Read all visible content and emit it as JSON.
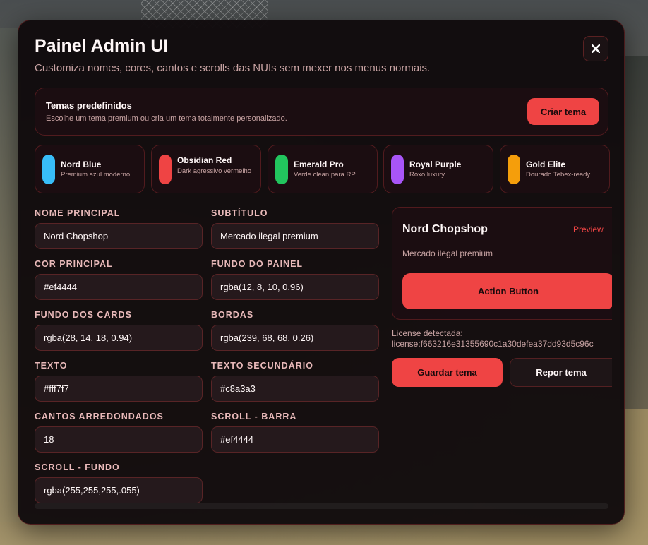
{
  "header": {
    "title": "Painel Admin UI",
    "subtitle": "Customiza nomes, cores, cantos e scrolls das NUIs sem mexer nos menus normais."
  },
  "themes": {
    "title": "Temas predefinidos",
    "description": "Escolhe um tema premium ou cria um tema totalmente personalizado.",
    "create_label": "Criar tema"
  },
  "presets": [
    {
      "name": "Nord Blue",
      "description": "Premium azul moderno",
      "color": "#38bdf8"
    },
    {
      "name": "Obsidian Red",
      "description": "Dark agressivo vermelho",
      "color": "#ef4444"
    },
    {
      "name": "Emerald Pro",
      "description": "Verde clean para RP",
      "color": "#22c55e"
    },
    {
      "name": "Royal Purple",
      "description": "Roxo luxury",
      "color": "#a855f7"
    },
    {
      "name": "Gold Elite",
      "description": "Dourado Tebex-ready",
      "color": "#f59e0b"
    }
  ],
  "fields": {
    "nome_principal": {
      "label": "Nome principal",
      "value": "Nord Chopshop"
    },
    "subtitulo": {
      "label": "Subtítulo",
      "value": "Mercado ilegal premium"
    },
    "cor_principal": {
      "label": "Cor principal",
      "value": "#ef4444"
    },
    "fundo_painel": {
      "label": "Fundo do painel",
      "value": "rgba(12, 8, 10, 0.96)"
    },
    "fundo_cards": {
      "label": "Fundo dos cards",
      "value": "rgba(28, 14, 18, 0.94)"
    },
    "bordas": {
      "label": "Bordas",
      "value": "rgba(239, 68, 68, 0.26)"
    },
    "texto": {
      "label": "Texto",
      "value": "#fff7f7"
    },
    "texto_secundario": {
      "label": "Texto secundário",
      "value": "#c8a3a3"
    },
    "cantos": {
      "label": "Cantos arredondados",
      "value": "18"
    },
    "scroll_barra": {
      "label": "Scroll - barra",
      "value": "#ef4444"
    },
    "scroll_fundo": {
      "label": "Scroll - fundo",
      "value": "rgba(255,255,255,.055)"
    }
  },
  "preview": {
    "name": "Nord Chopshop",
    "tag": "Preview",
    "subtitle": "Mercado ilegal premium",
    "action_label": "Action Button"
  },
  "license": {
    "label": "License detectada:",
    "value": "license:f663216e31355690c1a30defea37dd93d5c96c"
  },
  "actions": {
    "save_label": "Guardar tema",
    "reset_label": "Repor tema"
  },
  "colors": {
    "accent": "#ef4444",
    "text": "#fff7f7",
    "text_secondary": "#c8a3a3"
  }
}
